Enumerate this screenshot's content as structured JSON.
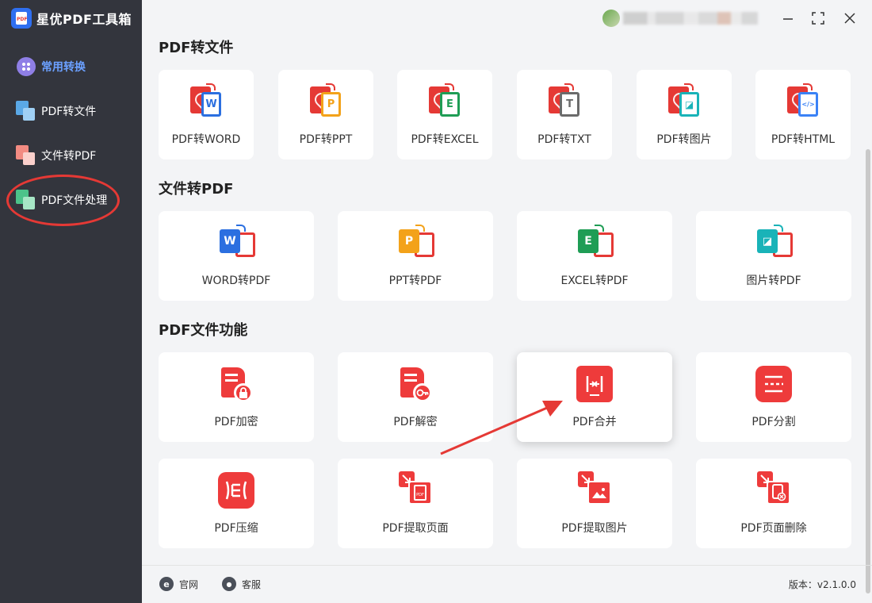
{
  "app": {
    "title": "星优PDF工具箱"
  },
  "sidebar": {
    "items": [
      {
        "label": "常用转换",
        "icon": "grid-icon",
        "active": true
      },
      {
        "label": "PDF转文件",
        "icon": "pdf-to-file-icon"
      },
      {
        "label": "文件转PDF",
        "icon": "file-to-pdf-icon"
      },
      {
        "label": "PDF文件处理",
        "icon": "pdf-process-icon",
        "highlighted": true
      }
    ]
  },
  "sections": {
    "pdf_to_file": {
      "title": "PDF转文件",
      "cards": [
        {
          "label": "PDF转WORD",
          "glyph": "W",
          "color": "#2b6fe0"
        },
        {
          "label": "PDF转PPT",
          "glyph": "P",
          "color": "#f3a21a"
        },
        {
          "label": "PDF转EXCEL",
          "glyph": "E",
          "color": "#1f9d55"
        },
        {
          "label": "PDF转TXT",
          "glyph": "T",
          "color": "#6b6b6b"
        },
        {
          "label": "PDF转图片",
          "glyph": "◪",
          "color": "#19b3b8"
        },
        {
          "label": "PDF转HTML",
          "glyph": "</>",
          "color": "#3b82f6"
        }
      ]
    },
    "file_to_pdf": {
      "title": "文件转PDF",
      "cards": [
        {
          "label": "WORD转PDF",
          "glyph": "W",
          "color": "#2b6fe0"
        },
        {
          "label": "PPT转PDF",
          "glyph": "P",
          "color": "#f3a21a"
        },
        {
          "label": "EXCEL转PDF",
          "glyph": "E",
          "color": "#1f9d55"
        },
        {
          "label": "图片转PDF",
          "glyph": "◪",
          "color": "#19b3b8"
        }
      ]
    },
    "pdf_functions": {
      "title": "PDF文件功能",
      "cards": [
        {
          "label": "PDF加密",
          "icon": "lock-icon"
        },
        {
          "label": "PDF解密",
          "icon": "key-icon"
        },
        {
          "label": "PDF合并",
          "icon": "merge-icon",
          "selected": true
        },
        {
          "label": "PDF分割",
          "icon": "split-icon"
        },
        {
          "label": "PDF压缩",
          "icon": "compress-icon"
        },
        {
          "label": "PDF提取页面",
          "icon": "extract-page-icon",
          "badge": "PDF"
        },
        {
          "label": "PDF提取图片",
          "icon": "extract-image-icon"
        },
        {
          "label": "PDF页面删除",
          "icon": "delete-page-icon"
        }
      ]
    }
  },
  "footer": {
    "website": {
      "label": "官网",
      "glyph": "e"
    },
    "support": {
      "label": "客服",
      "glyph": "●"
    },
    "version": "版本：v2.1.0.0"
  },
  "colors": {
    "accent": "#ee3b3b",
    "sidebar_bg": "#33353d",
    "active_nav": "#6ba0ff",
    "annotation": "#e53935"
  }
}
